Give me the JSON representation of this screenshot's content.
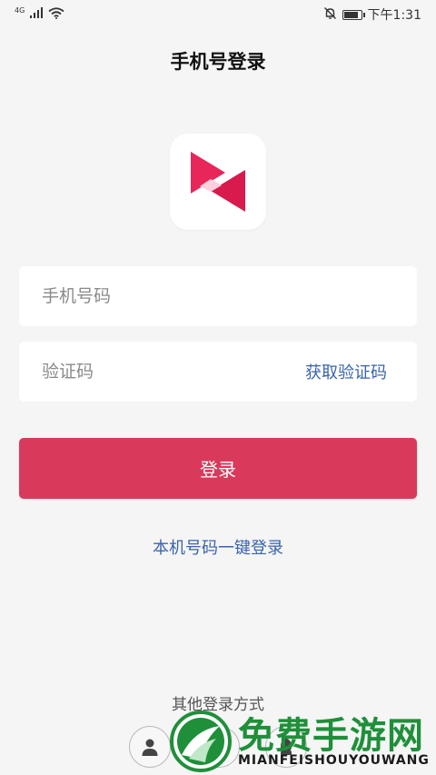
{
  "status_bar": {
    "network_type": "4G",
    "time": "下午1:31",
    "battery_level": 0.9
  },
  "page": {
    "title": "手机号登录"
  },
  "app_logo": {
    "icon": "bowtie-play-logo",
    "colors": [
      "#e8265a",
      "#d81b4c",
      "#ffd1de"
    ]
  },
  "form": {
    "phone_placeholder": "手机号码",
    "phone_value": "",
    "code_placeholder": "验证码",
    "code_value": "",
    "get_code_label": "获取验证码"
  },
  "login_button": {
    "label": "登录",
    "color": "#d93a5c"
  },
  "one_key_login": {
    "label": "本机号码一键登录",
    "color": "#3a63ad"
  },
  "other_login": {
    "title": "其他登录方式",
    "options": [
      {
        "icon": "person-icon"
      },
      {
        "icon": "wechat-icon"
      },
      {
        "icon": "qq-icon"
      }
    ]
  },
  "watermark": {
    "text_cn": "免费手游网",
    "text_en": "MIANFEISHOUYOUWANG",
    "color": "#1f8f3a"
  }
}
